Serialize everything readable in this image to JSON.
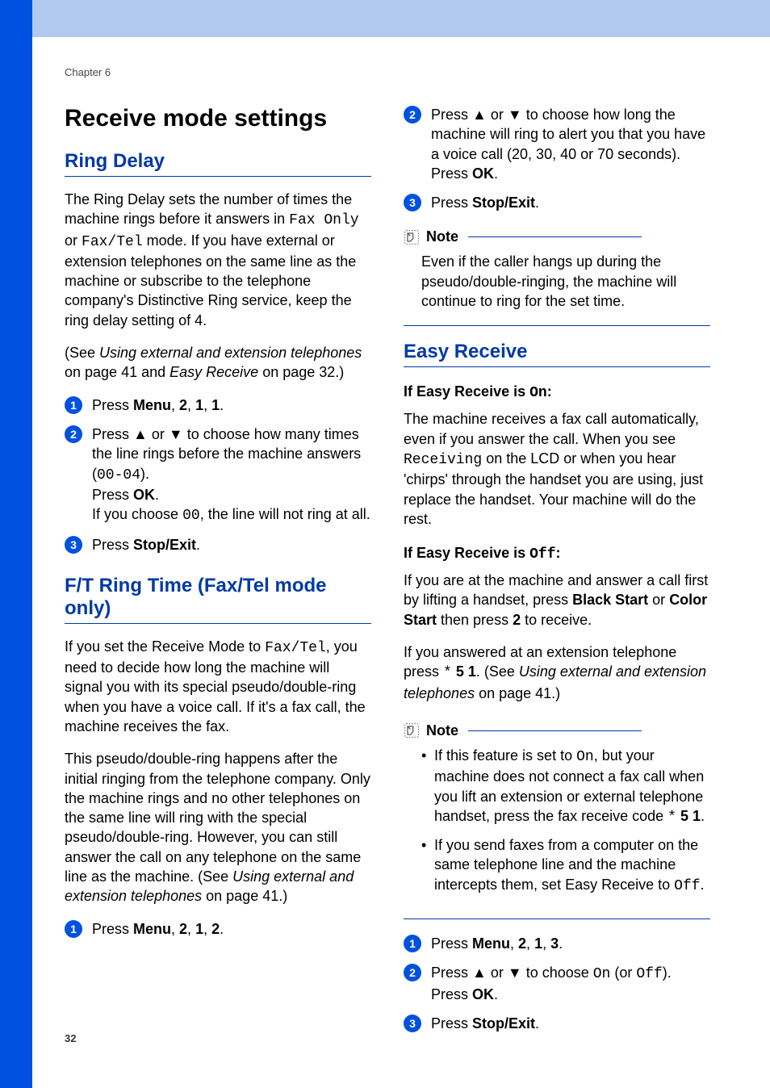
{
  "chapter": "Chapter 6",
  "page_number": "32",
  "h1": "Receive mode settings",
  "left": {
    "h2a": "Ring Delay",
    "p1_a": "The Ring Delay sets the number of times the machine rings before it answers in ",
    "p1_mono1": "Fax Only",
    "p1_b": " or ",
    "p1_mono2": "Fax/Tel",
    "p1_c": " mode. If you have external or extension telephones on the same line as the machine or subscribe to the telephone company's Distinctive Ring service, keep the ring delay setting of 4.",
    "p2_a": "(See ",
    "p2_i1": "Using external and extension telephones",
    "p2_b": " on page 41 and ",
    "p2_i2": "Easy Receive",
    "p2_c": " on page 32.)",
    "s1_a": "Press ",
    "s1_b": "Menu",
    "s1_c": ", ",
    "s1_d": "2",
    "s1_e": ", ",
    "s1_f": "1",
    "s1_g": ", ",
    "s1_h": "1",
    "s1_i": ".",
    "s2_a": "Press ",
    "s2_up": "▲",
    "s2_b": " or ",
    "s2_dn": "▼",
    "s2_c": " to choose how many times the line rings before the machine answers (",
    "s2_mono": "00-04",
    "s2_d": ").",
    "s2_e": "Press ",
    "s2_f": "OK",
    "s2_g": ".",
    "s2_h": "If you choose ",
    "s2_mono2": "00",
    "s2_i": ", the line will not ring at all.",
    "s3_a": "Press ",
    "s3_b": "Stop/Exit",
    "s3_c": ".",
    "h2b": "F/T Ring Time (Fax/Tel mode only)",
    "p3_a": "If you set the Receive Mode to ",
    "p3_mono": "Fax/Tel",
    "p3_b": ", you need to decide how long the machine will signal you with its special pseudo/double-ring when you have a voice call. If it's a fax call, the machine receives the fax.",
    "p4_a": "This pseudo/double-ring happens after the initial ringing from the telephone company. Only the machine rings and no other telephones on the same line will ring with the special pseudo/double-ring. However, you can still answer the call on any telephone on the same line as the machine. (See ",
    "p4_i": "Using external and extension telephones",
    "p4_b": " on page 41.)",
    "s4_a": "Press ",
    "s4_b": "Menu",
    "s4_c": ", ",
    "s4_d": "2",
    "s4_e": ", ",
    "s4_f": "1",
    "s4_g": ", ",
    "s4_h": "2",
    "s4_i": "."
  },
  "right": {
    "s2_a": "Press ",
    "s2_up": "▲",
    "s2_b": " or ",
    "s2_dn": "▼",
    "s2_c": " to choose how long the machine will ring to alert you that you have a voice call (20, 30, 40 or 70 seconds).",
    "s2_d": "Press ",
    "s2_e": "OK",
    "s2_f": ".",
    "s3_a": "Press ",
    "s3_b": "Stop/Exit",
    "s3_c": ".",
    "note_title": "Note",
    "note_body": "Even if the caller hangs up during the pseudo/double-ringing, the machine will continue to ring for the set time.",
    "h2": "Easy Receive",
    "sub1_a": "If Easy Receive is ",
    "sub1_mono": "On",
    "sub1_b": ":",
    "p1_a": "The machine receives a fax call automatically, even if you answer the call. When you see ",
    "p1_mono": "Receiving",
    "p1_b": " on the LCD or when you hear 'chirps' through the handset you are using, just replace the handset. Your machine will do the rest.",
    "sub2_a": "If Easy Receive is ",
    "sub2_mono": "Off",
    "sub2_b": ":",
    "p2_a": "If you are at the machine and answer a call first by lifting a handset, press ",
    "p2_b": "Black Start",
    "p2_c": " or ",
    "p2_d": "Color Start",
    "p2_e": " then press ",
    "p2_f": "2",
    "p2_g": " to receive.",
    "p3_a": "If you answered at an extension telephone press ",
    "p3_mono": "*",
    "p3_b": " 5 1",
    "p3_c": ". (See ",
    "p3_i": "Using external and extension telephones",
    "p3_d": " on page 41.)",
    "note2_title": "Note",
    "n2_li1_a": "If this feature is set to ",
    "n2_li1_mono": "On",
    "n2_li1_b": ", but your machine does not connect a fax call when you lift an extension or external telephone handset, press the fax receive code ",
    "n2_li1_mono2": "*",
    "n2_li1_c": " 5 1",
    "n2_li1_d": ".",
    "n2_li2_a": "If you send faxes from a computer on the same telephone line and the machine intercepts them, set Easy Receive to ",
    "n2_li2_mono": "Off",
    "n2_li2_b": ".",
    "rs1_a": "Press ",
    "rs1_b": "Menu",
    "rs1_c": ", ",
    "rs1_d": "2",
    "rs1_e": ", ",
    "rs1_f": "1",
    "rs1_g": ", ",
    "rs1_h": "3",
    "rs1_i": ".",
    "rs2_a": "Press ",
    "rs2_up": "▲",
    "rs2_b": " or ",
    "rs2_dn": "▼",
    "rs2_c": " to choose ",
    "rs2_mono1": "On",
    "rs2_d": " (or ",
    "rs2_mono2": "Off",
    "rs2_e": ").",
    "rs2_f": "Press ",
    "rs2_g": "OK",
    "rs2_h": ".",
    "rs3_a": "Press ",
    "rs3_b": "Stop/Exit",
    "rs3_c": "."
  }
}
